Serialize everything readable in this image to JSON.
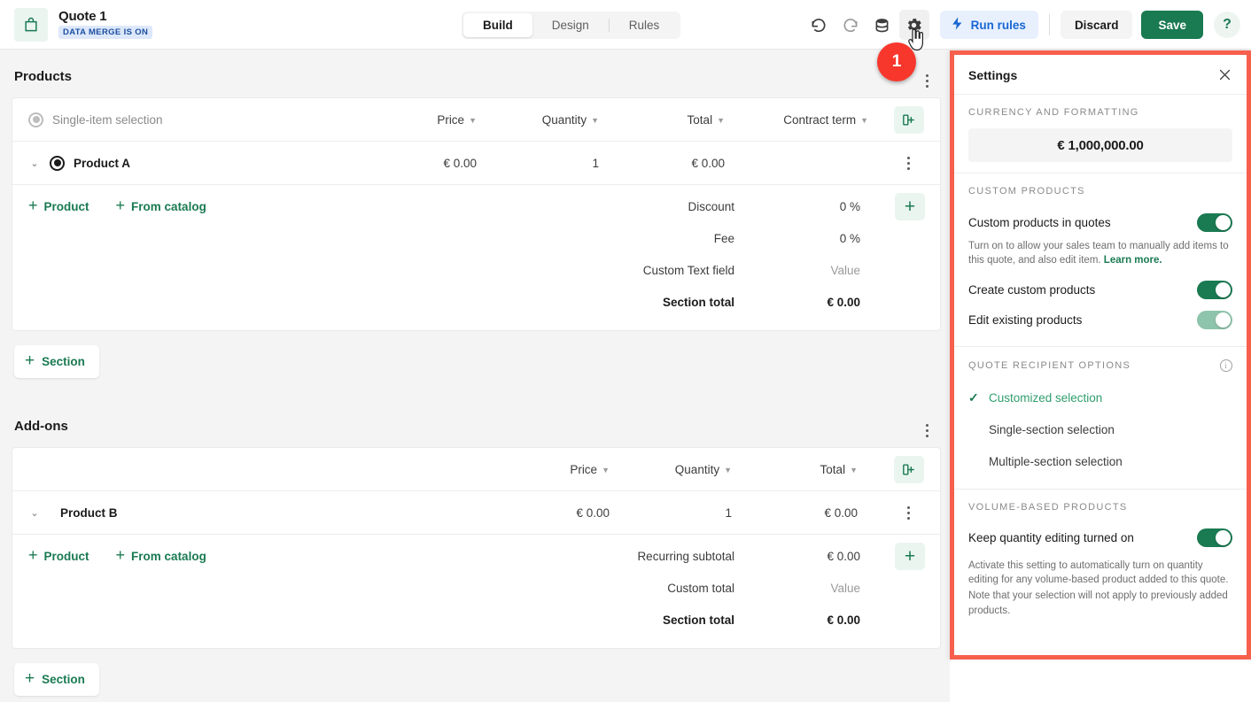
{
  "header": {
    "doc_icon": "bag-icon",
    "title": "Quote 1",
    "badge": "DATA MERGE IS ON",
    "tabs": [
      {
        "label": "Build",
        "active": true
      },
      {
        "label": "Design",
        "active": false
      },
      {
        "label": "Rules",
        "active": false
      }
    ],
    "undo_icon": "undo-icon",
    "redo_icon": "redo-icon",
    "database_icon": "database-icon",
    "settings_icon": "gear-icon",
    "run_rules_label": "Run rules",
    "run_rules_icon": "lightning-icon",
    "discard_label": "Discard",
    "save_label": "Save",
    "help_label": "?"
  },
  "annotation": {
    "step_number": "1",
    "color": "#f8372c"
  },
  "colors": {
    "brand_green": "#1a7a52",
    "link_blue": "#1967d2",
    "badge_blue_bg": "#dde8fa",
    "highlight_red": "#f75f4d",
    "toggle_on": "#1a7a52",
    "toggle_pale": "#8ec4ab"
  },
  "sections": [
    {
      "title": "Products",
      "selection_mode": "Single-item selection",
      "columns": [
        {
          "label": "Price",
          "sortable": true
        },
        {
          "label": "Quantity",
          "sortable": true
        },
        {
          "label": "Total",
          "sortable": true
        },
        {
          "label": "Contract term",
          "sortable": true
        }
      ],
      "add_column_icon": "add-column-icon",
      "rows": [
        {
          "name": "Product A",
          "price": "€ 0.00",
          "quantity": "1",
          "total": "€ 0.00",
          "term": ""
        }
      ],
      "add_links": [
        {
          "label": "Product"
        },
        {
          "label": "From catalog"
        }
      ],
      "totals": [
        {
          "label": "Discount",
          "value": "0 %",
          "bold": false,
          "muted": false
        },
        {
          "label": "Fee",
          "value": "0 %",
          "bold": false,
          "muted": false
        },
        {
          "label": "Custom Text field",
          "value": "Value",
          "bold": false,
          "muted": true
        },
        {
          "label": "Section total",
          "value": "€ 0.00",
          "bold": true,
          "muted": false
        }
      ],
      "add_total_label": "+"
    },
    {
      "title": "Add-ons",
      "selection_mode": "",
      "columns": [
        {
          "label": "Price",
          "sortable": true
        },
        {
          "label": "Quantity",
          "sortable": true
        },
        {
          "label": "Total",
          "sortable": true
        }
      ],
      "add_column_icon": "add-column-icon",
      "rows": [
        {
          "name": "Product B",
          "price": "€ 0.00",
          "quantity": "1",
          "total": "€ 0.00",
          "term": ""
        }
      ],
      "add_links": [
        {
          "label": "Product"
        },
        {
          "label": "From catalog"
        }
      ],
      "totals": [
        {
          "label": "Recurring subtotal",
          "value": "€ 0.00",
          "bold": false,
          "muted": false
        },
        {
          "label": "Custom total",
          "value": "Value",
          "bold": false,
          "muted": true
        },
        {
          "label": "Section total",
          "value": "€ 0.00",
          "bold": true,
          "muted": false
        }
      ],
      "add_total_label": "+"
    }
  ],
  "add_section_label": "Section",
  "settings": {
    "title": "Settings",
    "close_icon": "close-icon",
    "currency": {
      "heading": "CURRENCY AND FORMATTING",
      "value": "€ 1,000,000.00"
    },
    "custom_products": {
      "heading": "CUSTOM PRODUCTS",
      "main_toggle": {
        "label": "Custom products in quotes",
        "on": true,
        "pale": false
      },
      "help": "Turn on to allow your sales team to manually add items to this quote, and also edit item.",
      "help_link": "Learn more.",
      "toggles": [
        {
          "label": "Create custom products",
          "on": true,
          "pale": false
        },
        {
          "label": "Edit existing products",
          "on": true,
          "pale": true
        }
      ]
    },
    "recipient_options": {
      "heading": "QUOTE RECIPIENT OPTIONS",
      "info_icon": "info-icon",
      "options": [
        {
          "label": "Customized selection",
          "selected": true
        },
        {
          "label": "Single-section selection",
          "selected": false
        },
        {
          "label": "Multiple-section selection",
          "selected": false
        }
      ]
    },
    "volume_based": {
      "heading": "VOLUME-BASED PRODUCTS",
      "toggle": {
        "label": "Keep quantity editing turned on",
        "on": true,
        "pale": false
      },
      "help_line_1": "Activate this setting to automatically turn on quantity editing for any volume-based product added to this quote.",
      "help_line_2": "Note that your selection will not apply to previously added products."
    }
  }
}
